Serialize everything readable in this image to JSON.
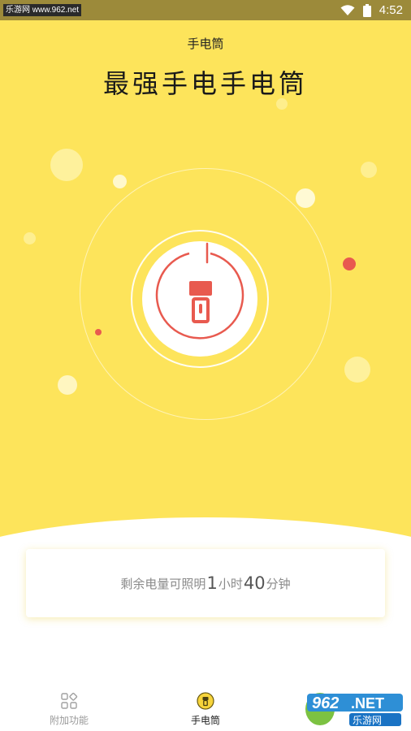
{
  "status_bar": {
    "watermark": "乐游网 www.962.net",
    "time": "4:52"
  },
  "header": {
    "title": "手电筒"
  },
  "hero": {
    "title": "最强手电手电筒"
  },
  "flashlight": {
    "power_icon": "power-flashlight-icon"
  },
  "battery_info": {
    "prefix": "剩余电量可照明",
    "hours": "1",
    "hours_unit": "小时",
    "minutes": "40",
    "minutes_unit": "分钟"
  },
  "bottom_nav": {
    "items": [
      {
        "label": "附加功能",
        "icon": "grid-icon"
      },
      {
        "label": "手电筒",
        "icon": "flashlight-icon"
      }
    ]
  },
  "logo": {
    "brand": "962.NET",
    "sub": "乐游网"
  },
  "colors": {
    "primary_yellow": "#fde45b",
    "accent_red": "#e85a4f",
    "status_bar": "#9c8a3a"
  }
}
